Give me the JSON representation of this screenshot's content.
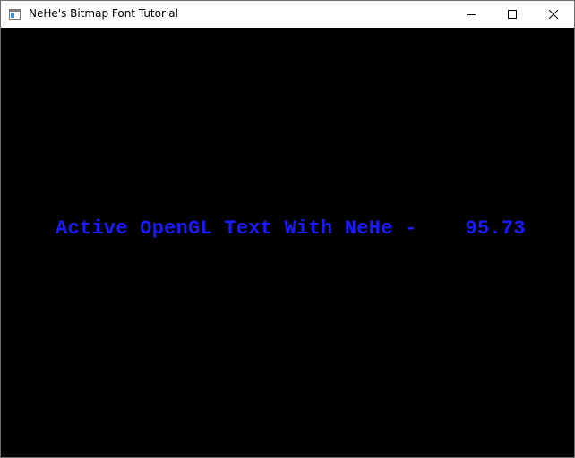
{
  "window": {
    "title": "NeHe's Bitmap Font Tutorial",
    "icon": "window-app-icon",
    "controls": {
      "minimize_icon": "minimize-icon",
      "maximize_icon": "maximize-icon",
      "close_icon": "close-icon"
    }
  },
  "canvas": {
    "background": "#000000",
    "text": {
      "label": "Active OpenGL Text With NeHe - ",
      "value": "   95.73",
      "color": "#1a1aff"
    }
  }
}
